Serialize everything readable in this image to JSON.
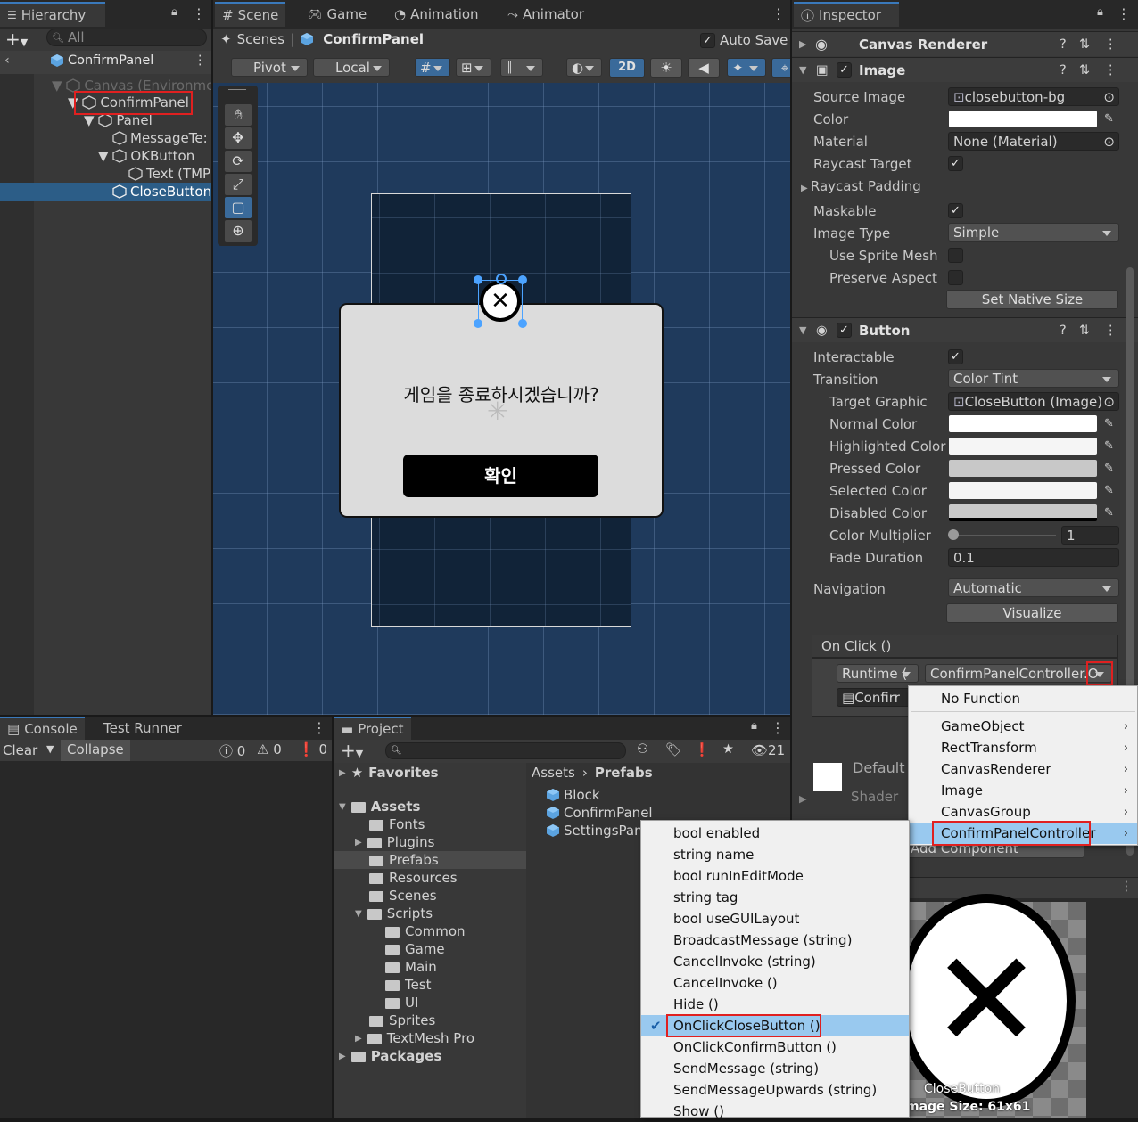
{
  "hierarchy": {
    "tab": "Hierarchy",
    "search_placeholder": "All",
    "scene_root": "ConfirmPanel",
    "items": [
      {
        "label": "Canvas (Environme"
      },
      {
        "label": "ConfirmPanel"
      },
      {
        "label": "Panel"
      },
      {
        "label": "MessageTe:"
      },
      {
        "label": "OKButton"
      },
      {
        "label": "Text (TMP"
      },
      {
        "label": "CloseButton"
      }
    ]
  },
  "scene": {
    "tabs": [
      "Scene",
      "Game",
      "Animation",
      "Animator"
    ],
    "breadcrumb_root": "Scenes",
    "breadcrumb_current": "ConfirmPanel",
    "auto_save": "Auto Save",
    "toolbar": {
      "pivot": "Pivot",
      "local": "Local",
      "mode2d": "2D"
    },
    "dialog": {
      "message": "게임을 종료하시겠습니까?",
      "ok_label": "확인"
    }
  },
  "inspector": {
    "tab": "Inspector",
    "canvas_renderer": "Canvas Renderer",
    "image": {
      "title": "Image",
      "source_image_label": "Source Image",
      "source_image": "closebutton-bg",
      "color_label": "Color",
      "material_label": "Material",
      "material": "None (Material)",
      "raycast_target_label": "Raycast Target",
      "raycast_padding_label": "Raycast Padding",
      "maskable_label": "Maskable",
      "image_type_label": "Image Type",
      "image_type": "Simple",
      "use_sprite_mesh_label": "Use Sprite Mesh",
      "preserve_aspect_label": "Preserve Aspect",
      "set_native_size": "Set Native Size"
    },
    "button": {
      "title": "Button",
      "interactable_label": "Interactable",
      "transition_label": "Transition",
      "transition": "Color Tint",
      "target_graphic_label": "Target Graphic",
      "target_graphic": "CloseButton (Image)",
      "normal_color_label": "Normal Color",
      "highlighted_color_label": "Highlighted Color",
      "pressed_color_label": "Pressed Color",
      "selected_color_label": "Selected Color",
      "disabled_color_label": "Disabled Color",
      "color_multiplier_label": "Color Multiplier",
      "color_multiplier": "1",
      "fade_duration_label": "Fade Duration",
      "fade_duration": "0.1",
      "navigation_label": "Navigation",
      "navigation": "Automatic",
      "visualize": "Visualize",
      "onclick": {
        "title": "On Click ()",
        "runtime": "Runtime (",
        "function": "ConfirmPanelController.O",
        "object": "Confirr"
      }
    },
    "material_preview": {
      "default": "Default",
      "shader": "Shader"
    },
    "add_component": "Add Component",
    "preview": {
      "name": "CloseButton",
      "size": "mage Size: 61x61"
    }
  },
  "console": {
    "tabs": [
      "Console",
      "Test Runner"
    ],
    "clear": "Clear",
    "collapse": "Collapse",
    "counts": [
      "0",
      "0",
      "0"
    ]
  },
  "project": {
    "tab": "Project",
    "hidden_count": "21",
    "favorites": "Favorites",
    "assets": "Assets",
    "packages": "Packages",
    "tree": [
      "Fonts",
      "Plugins",
      "Prefabs",
      "Resources",
      "Scenes",
      "Scripts",
      "Common",
      "Game",
      "Main",
      "Test",
      "UI",
      "Sprites",
      "TextMesh Pro"
    ],
    "breadcrumb": [
      "Assets",
      "Prefabs"
    ],
    "files": [
      "Block",
      "ConfirmPanel",
      "SettingsPan"
    ]
  },
  "function_menu": {
    "items": [
      "No Function",
      "GameObject",
      "RectTransform",
      "CanvasRenderer",
      "Image",
      "CanvasGroup",
      "ConfirmPanelController"
    ]
  },
  "method_menu": {
    "items": [
      "bool enabled",
      "string name",
      "bool runInEditMode",
      "string tag",
      "bool useGUILayout",
      "BroadcastMessage (string)",
      "CancelInvoke (string)",
      "CancelInvoke ()",
      "Hide ()",
      "OnClickCloseButton ()",
      "OnClickConfirmButton ()",
      "SendMessage (string)",
      "SendMessageUpwards (string)",
      "Show ()"
    ],
    "selected_index": 9
  }
}
